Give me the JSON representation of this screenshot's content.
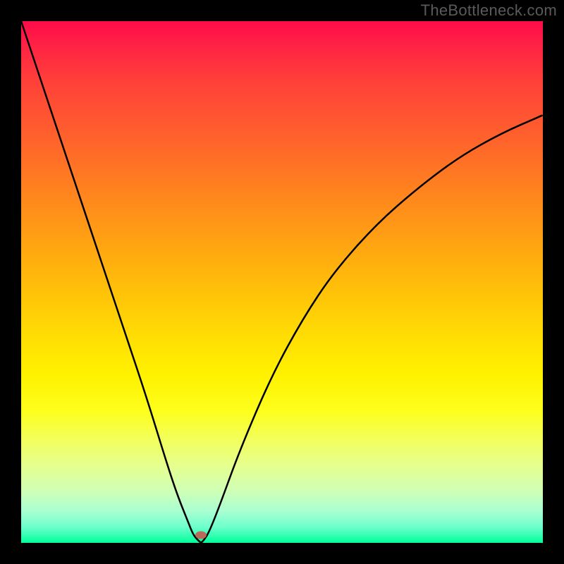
{
  "attribution": "TheBottleneck.com",
  "marker": {
    "x_pct": 34.5,
    "y_pct": 98.5
  },
  "colors": {
    "frame": "#000000",
    "marker": "#b96a5a",
    "curve": "#000000",
    "gradient_top": "#ff0b49",
    "gradient_bottom": "#00ff99"
  },
  "chart_data": {
    "type": "line",
    "title": "",
    "xlabel": "",
    "ylabel": "",
    "xlim": [
      0,
      100
    ],
    "ylim": [
      0,
      100
    ],
    "grid": false,
    "legend": false,
    "series": [
      {
        "name": "bottleneck-curve",
        "x": [
          0,
          4,
          8,
          12,
          16,
          20,
          24,
          28,
          30,
          32,
          33,
          34,
          34.5,
          35,
          36,
          38,
          42,
          48,
          54,
          60,
          68,
          76,
          84,
          92,
          100
        ],
        "y": [
          100,
          88,
          76,
          64,
          52,
          40,
          28,
          15,
          9,
          4,
          1.5,
          0.4,
          0,
          0.5,
          2,
          7,
          18,
          32,
          43,
          52,
          61,
          68,
          74,
          78.5,
          82
        ]
      }
    ],
    "annotations": [
      {
        "type": "marker",
        "x": 34.5,
        "y": 1.5,
        "label": "optimal-point"
      }
    ],
    "background": "vertical-gradient red→yellow→green (top=high bottleneck, bottom=low)"
  }
}
